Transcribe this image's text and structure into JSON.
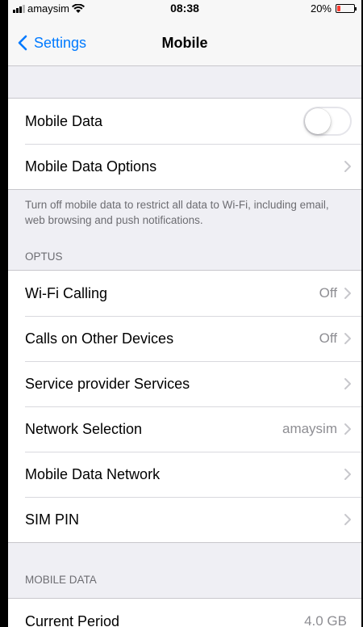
{
  "status_bar": {
    "carrier": "amaysim",
    "time": "08:38",
    "battery": "20%",
    "battery_level": 0.2
  },
  "nav": {
    "back_label": "Settings",
    "title": "Mobile"
  },
  "group1": {
    "mobile_data": {
      "label": "Mobile Data",
      "toggle_on": false
    },
    "mobile_data_options": {
      "label": "Mobile Data Options"
    }
  },
  "group1_footer": "Turn off mobile data to restrict all data to Wi-Fi, including email, web browsing and push notifications.",
  "optus_header": "OPTUS",
  "optus": {
    "wifi_calling": {
      "label": "Wi-Fi Calling",
      "value": "Off"
    },
    "calls_other": {
      "label": "Calls on Other Devices",
      "value": "Off"
    },
    "provider_services": {
      "label": "Service provider Services"
    },
    "network_selection": {
      "label": "Network Selection",
      "value": "amaysim"
    },
    "mobile_data_network": {
      "label": "Mobile Data Network"
    },
    "sim_pin": {
      "label": "SIM PIN"
    }
  },
  "mobile_data_header": "MOBILE DATA",
  "mobile_data_section": {
    "current_period": {
      "label": "Current Period",
      "value": "4.0 GB"
    }
  }
}
